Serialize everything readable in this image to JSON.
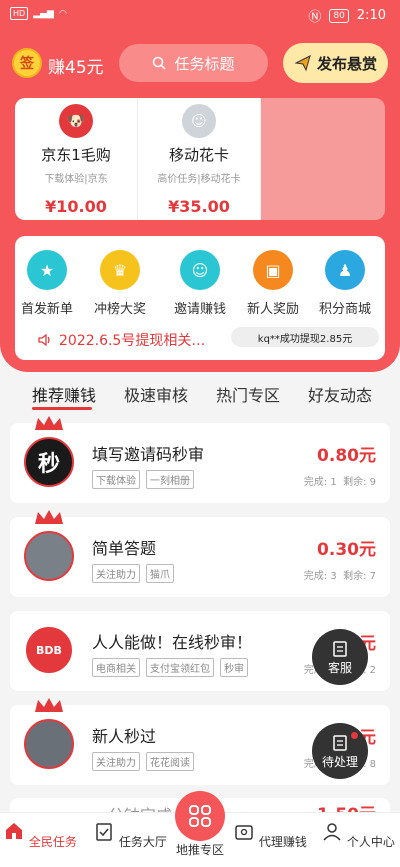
{
  "statusbar": {
    "left": "HD",
    "battery": "80",
    "time": "2:10"
  },
  "header": {
    "coin_icon": "签",
    "earn": "赚45元",
    "search_placeholder": "任务标题",
    "publish": "发布悬赏"
  },
  "featured": [
    {
      "title": "京东1毛购",
      "subtitle": "下载体验|京东",
      "price": "¥10.00",
      "icon": "jd-icon"
    },
    {
      "title": "移动花卡",
      "subtitle": "高价任务|移动花卡",
      "price": "¥35.00",
      "icon": "user-photo"
    }
  ],
  "shortcuts": [
    {
      "label": "首发新单",
      "color": "#2bc6d3",
      "glyph": "★"
    },
    {
      "label": "冲榜大奖",
      "color": "#f6c21c",
      "glyph": "♛"
    },
    {
      "label": "邀请赚钱",
      "color": "#2bc6d3",
      "glyph": "☺"
    },
    {
      "label": "新人奖励",
      "color": "#f5891f",
      "glyph": "▣"
    },
    {
      "label": "积分商城",
      "color": "#2ba8e0",
      "glyph": "♟"
    }
  ],
  "notice": "2022.6.5号提现相关…",
  "withdraw_ticker": "kq**成功提现2.85元",
  "tabs": [
    "推荐赚钱",
    "极速审核",
    "热门专区",
    "好友动态"
  ],
  "tasks": [
    {
      "title": "填写邀请码秒审",
      "tags": [
        "下载体验",
        "一刻相册"
      ],
      "price": "0.80元",
      "done": "完成: 1",
      "left": "剩余: 9",
      "avatar": "秒"
    },
    {
      "title": "简单答题",
      "tags": [
        "关注助力",
        "猫爪"
      ],
      "price": "0.30元",
      "done": "完成: 3",
      "left": "剩余: 7",
      "avatar": ""
    },
    {
      "title": "人人能做！在线秒审！",
      "tags": [
        "电商相关",
        "支付宝领红包",
        "秒审"
      ],
      "price": "0.55元",
      "done": "完成: 8",
      "left": "剩余: 2",
      "avatar": "BDB"
    },
    {
      "title": "新人秒过",
      "tags": [
        "关注助力",
        "花花阅读"
      ],
      "price": "0.15元",
      "done": "完成: 2",
      "left": "剩余: 8",
      "avatar": ""
    }
  ],
  "partial_task": {
    "title": "…分钟完成",
    "price": "1.50元"
  },
  "float_buttons": {
    "service": "客服",
    "pending": "待处理"
  },
  "bottomnav": [
    "全民任务",
    "任务大厅",
    "地推专区",
    "代理赚钱",
    "个人中心"
  ],
  "colors": {
    "brand": "#f4565a",
    "price": "#e4393c"
  }
}
